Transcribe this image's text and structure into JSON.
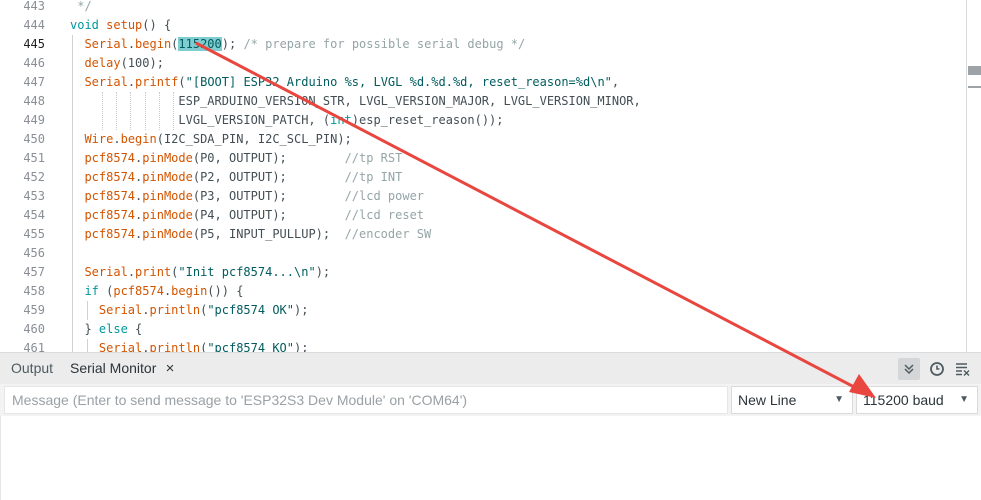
{
  "editor": {
    "line_numbers": [
      "443",
      "444",
      "445",
      "446",
      "447",
      "448",
      "449",
      "450",
      "451",
      "452",
      "453",
      "454",
      "455",
      "456",
      "457",
      "458",
      "459",
      "460",
      "461"
    ],
    "active_line": "445",
    "lines": [
      {
        "n": "443",
        "parts": [
          {
            "t": " */",
            "c": "cmt"
          }
        ]
      },
      {
        "n": "444",
        "parts": [
          {
            "t": "void",
            "c": "type"
          },
          {
            "t": " ",
            "c": ""
          },
          {
            "t": "setup",
            "c": "fn"
          },
          {
            "t": "() {",
            "c": ""
          }
        ]
      },
      {
        "n": "445",
        "parts": [
          {
            "t": "  ",
            "c": ""
          },
          {
            "t": "Serial",
            "c": "fn"
          },
          {
            "t": ".",
            "c": ""
          },
          {
            "t": "begin",
            "c": "fn"
          },
          {
            "t": "(",
            "c": ""
          },
          {
            "t": "115200",
            "c": "hl"
          },
          {
            "t": "); ",
            "c": ""
          },
          {
            "t": "/* prepare for possible serial debug */",
            "c": "cmt"
          }
        ]
      },
      {
        "n": "446",
        "parts": [
          {
            "t": "  ",
            "c": ""
          },
          {
            "t": "delay",
            "c": "fn"
          },
          {
            "t": "(100);",
            "c": ""
          }
        ]
      },
      {
        "n": "447",
        "parts": [
          {
            "t": "  ",
            "c": ""
          },
          {
            "t": "Serial",
            "c": "fn"
          },
          {
            "t": ".",
            "c": ""
          },
          {
            "t": "printf",
            "c": "fn"
          },
          {
            "t": "(",
            "c": ""
          },
          {
            "t": "\"[BOOT] ESP32 Arduino %s, LVGL %d.%d.%d, reset_reason=%d\\n\"",
            "c": "str"
          },
          {
            "t": ",",
            "c": ""
          }
        ]
      },
      {
        "n": "448",
        "parts": [
          {
            "t": "               ESP_ARDUINO_VERSION_STR, LVGL_VERSION_MAJOR, LVGL_VERSION_MINOR,",
            "c": ""
          }
        ]
      },
      {
        "n": "449",
        "parts": [
          {
            "t": "               LVGL_VERSION_PATCH, (",
            "c": ""
          },
          {
            "t": "int",
            "c": "type"
          },
          {
            "t": ")esp_reset_reason());",
            "c": ""
          }
        ]
      },
      {
        "n": "450",
        "parts": [
          {
            "t": "  ",
            "c": ""
          },
          {
            "t": "Wire",
            "c": "fn"
          },
          {
            "t": ".",
            "c": ""
          },
          {
            "t": "begin",
            "c": "fn"
          },
          {
            "t": "(I2C_SDA_PIN, I2C_SCL_PIN);",
            "c": ""
          }
        ]
      },
      {
        "n": "451",
        "parts": [
          {
            "t": "  ",
            "c": ""
          },
          {
            "t": "pcf8574",
            "c": "fn"
          },
          {
            "t": ".",
            "c": ""
          },
          {
            "t": "pinMode",
            "c": "fn"
          },
          {
            "t": "(P0, OUTPUT);        ",
            "c": ""
          },
          {
            "t": "//tp RST",
            "c": "cmt"
          }
        ]
      },
      {
        "n": "452",
        "parts": [
          {
            "t": "  ",
            "c": ""
          },
          {
            "t": "pcf8574",
            "c": "fn"
          },
          {
            "t": ".",
            "c": ""
          },
          {
            "t": "pinMode",
            "c": "fn"
          },
          {
            "t": "(P2, OUTPUT);        ",
            "c": ""
          },
          {
            "t": "//tp INT",
            "c": "cmt"
          }
        ]
      },
      {
        "n": "453",
        "parts": [
          {
            "t": "  ",
            "c": ""
          },
          {
            "t": "pcf8574",
            "c": "fn"
          },
          {
            "t": ".",
            "c": ""
          },
          {
            "t": "pinMode",
            "c": "fn"
          },
          {
            "t": "(P3, OUTPUT);        ",
            "c": ""
          },
          {
            "t": "//lcd power",
            "c": "cmt"
          }
        ]
      },
      {
        "n": "454",
        "parts": [
          {
            "t": "  ",
            "c": ""
          },
          {
            "t": "pcf8574",
            "c": "fn"
          },
          {
            "t": ".",
            "c": ""
          },
          {
            "t": "pinMode",
            "c": "fn"
          },
          {
            "t": "(P4, OUTPUT);        ",
            "c": ""
          },
          {
            "t": "//lcd reset",
            "c": "cmt"
          }
        ]
      },
      {
        "n": "455",
        "parts": [
          {
            "t": "  ",
            "c": ""
          },
          {
            "t": "pcf8574",
            "c": "fn"
          },
          {
            "t": ".",
            "c": ""
          },
          {
            "t": "pinMode",
            "c": "fn"
          },
          {
            "t": "(P5, INPUT_PULLUP);  ",
            "c": ""
          },
          {
            "t": "//encoder SW",
            "c": "cmt"
          }
        ]
      },
      {
        "n": "456",
        "parts": []
      },
      {
        "n": "457",
        "parts": [
          {
            "t": "  ",
            "c": ""
          },
          {
            "t": "Serial",
            "c": "fn"
          },
          {
            "t": ".",
            "c": ""
          },
          {
            "t": "print",
            "c": "fn"
          },
          {
            "t": "(",
            "c": ""
          },
          {
            "t": "\"Init pcf8574...\\n\"",
            "c": "str"
          },
          {
            "t": ");",
            "c": ""
          }
        ]
      },
      {
        "n": "458",
        "parts": [
          {
            "t": "  ",
            "c": ""
          },
          {
            "t": "if",
            "c": "type"
          },
          {
            "t": " (",
            "c": ""
          },
          {
            "t": "pcf8574",
            "c": "fn"
          },
          {
            "t": ".",
            "c": ""
          },
          {
            "t": "begin",
            "c": "fn"
          },
          {
            "t": "()) {",
            "c": ""
          }
        ]
      },
      {
        "n": "459",
        "parts": [
          {
            "t": "    ",
            "c": ""
          },
          {
            "t": "Serial",
            "c": "fn"
          },
          {
            "t": ".",
            "c": ""
          },
          {
            "t": "println",
            "c": "fn"
          },
          {
            "t": "(",
            "c": ""
          },
          {
            "t": "\"pcf8574 OK\"",
            "c": "str"
          },
          {
            "t": ");",
            "c": ""
          }
        ]
      },
      {
        "n": "460",
        "parts": [
          {
            "t": "  } ",
            "c": ""
          },
          {
            "t": "else",
            "c": "type"
          },
          {
            "t": " {",
            "c": ""
          }
        ]
      },
      {
        "n": "461",
        "parts": [
          {
            "t": "    ",
            "c": ""
          },
          {
            "t": "Serial",
            "c": "fn"
          },
          {
            "t": ".",
            "c": ""
          },
          {
            "t": "println",
            "c": "fn"
          },
          {
            "t": "(",
            "c": ""
          },
          {
            "t": "\"pcf8574 KO\"",
            "c": "str"
          },
          {
            "t": ");",
            "c": ""
          }
        ]
      }
    ]
  },
  "panel": {
    "tabs": {
      "output": "Output",
      "serial_monitor": "Serial Monitor",
      "close_glyph": "×"
    },
    "toolbar": {
      "autoscroll_icon": "double-chevron-down-icon",
      "timestamp_icon": "clock-icon",
      "clear_icon": "clear-output-icon"
    },
    "message_placeholder": "Message (Enter to send message to 'ESP32S3 Dev Module' on 'COM64')",
    "line_ending": "New Line",
    "baud_rate": "115200 baud"
  },
  "annotation": {
    "arrow_color": "#e8463f"
  },
  "colors": {
    "keyword": "#00979c",
    "function": "#d35400",
    "string": "#005c5f",
    "comment": "#95a5a6",
    "highlight": "#7fcdd0"
  }
}
